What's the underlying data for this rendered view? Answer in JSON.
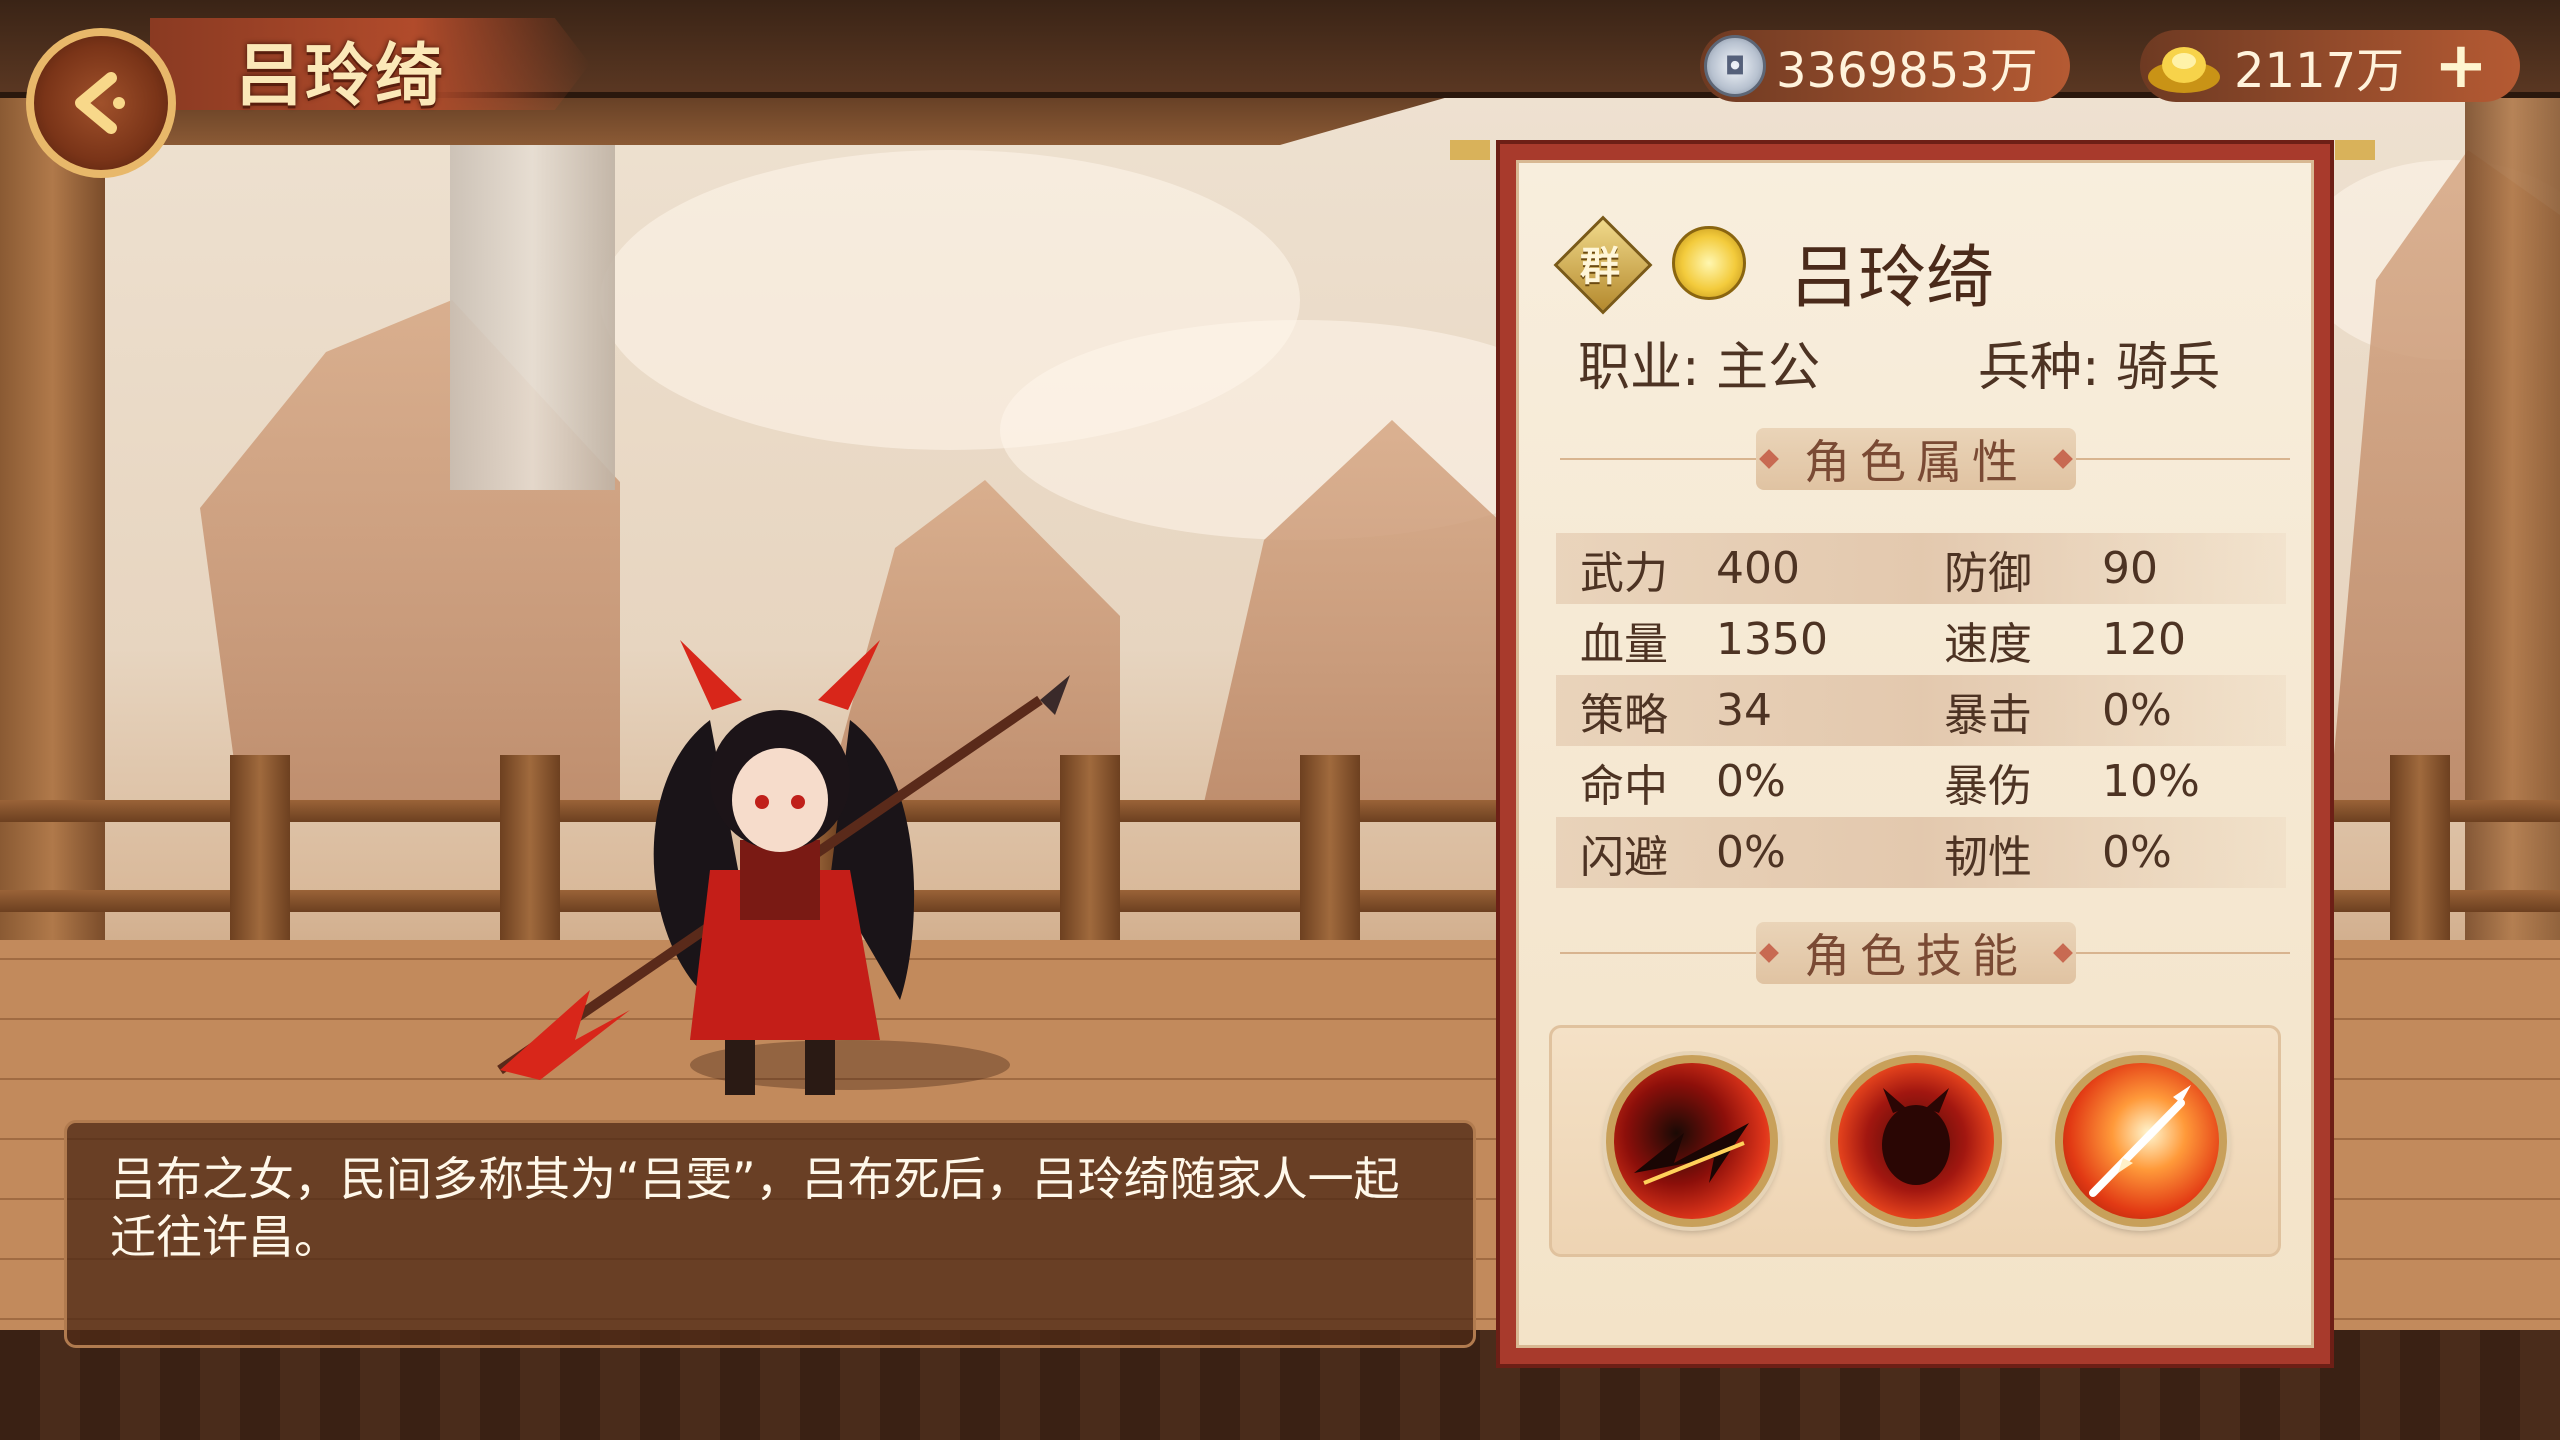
{
  "header": {
    "title": "吕玲绮",
    "silver": "3369853万",
    "gold": "2117万",
    "plus_label": "+"
  },
  "hero": {
    "faction": "群",
    "name": "吕玲绮",
    "profession_label": "职业:",
    "profession": "主公",
    "troop_label": "兵种:",
    "troop": "骑兵"
  },
  "attributes": {
    "section_title": "角色属性",
    "rows": [
      {
        "l1": "武力",
        "v1": "400",
        "l2": "防御",
        "v2": "90"
      },
      {
        "l1": "血量",
        "v1": "1350",
        "l2": "速度",
        "v2": "120"
      },
      {
        "l1": "策略",
        "v1": "34",
        "l2": "暴击",
        "v2": "0%"
      },
      {
        "l1": "命中",
        "v1": "0%",
        "l2": "暴伤",
        "v2": "10%"
      },
      {
        "l1": "闪避",
        "v1": "0%",
        "l2": "韧性",
        "v2": "0%"
      }
    ]
  },
  "skills": {
    "section_title": "角色技能",
    "items": [
      {
        "icon": "dragon-slash-skill-icon"
      },
      {
        "icon": "demon-rage-skill-icon"
      },
      {
        "icon": "spear-thrust-skill-icon"
      }
    ]
  },
  "description": "吕布之女，民间多称其为“吕雯”，吕布死后，吕玲绮随家人一起迁往许昌。",
  "colors": {
    "panel_frame": "#a83a2c",
    "panel_bg": "#f8eedd",
    "text_dark": "#4d3323",
    "title_gold": "#fbe8b8"
  }
}
